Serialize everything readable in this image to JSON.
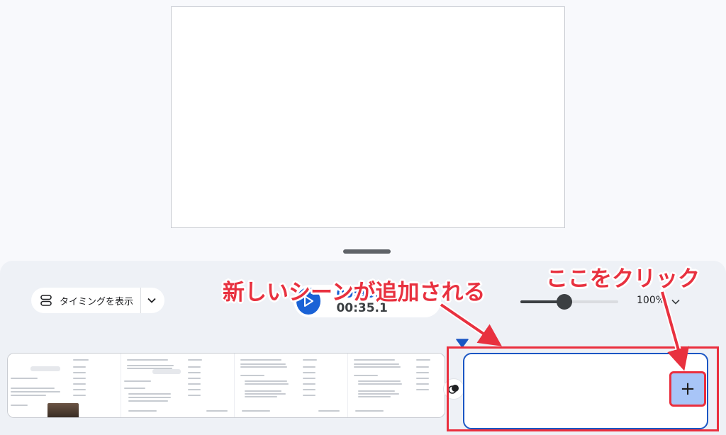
{
  "toolbar": {
    "timing_label": "タイミングを表示",
    "time_current": "00:30.1",
    "time_separator": " / ",
    "time_total": "00:35.1",
    "zoom_label": "100%"
  },
  "slider": {
    "value_fraction": 0.45
  },
  "annotations": {
    "left_callout": "新しいシーンが追加される",
    "right_callout": "ここをクリック"
  },
  "add_scene": {
    "label": "+"
  },
  "colors": {
    "accent": "#1a62d6",
    "annotation": "#e8313f",
    "selected_scene_border": "#1a56c4"
  },
  "icons": {
    "timing": "timing-icon",
    "chevron": "chevron-down-icon",
    "play": "play-icon",
    "transition": "transition-icon",
    "playhead": "playhead-marker-icon"
  }
}
